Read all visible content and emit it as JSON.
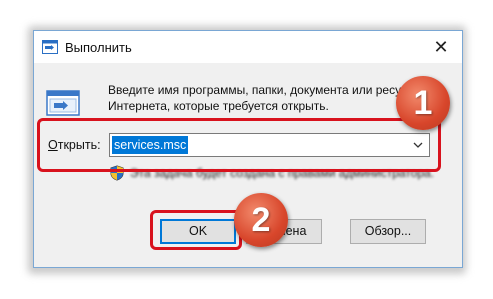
{
  "window": {
    "title": "Выполнить",
    "close_label": "✕"
  },
  "description": {
    "line1": "Введите имя программы, папки, документа или ресу",
    "line2": "Интернета, которые требуется открыть."
  },
  "open_field": {
    "label_prefix": "О",
    "label_rest": "ткрыть:",
    "value": "services.msc"
  },
  "admin_note": "Эта задача будет создана с правами администратора.",
  "buttons": {
    "ok": "OK",
    "cancel": "Отмена",
    "browse": "Обзор..."
  },
  "badges": {
    "step1": "1",
    "step2": "2"
  },
  "colors": {
    "highlight": "#d8121d",
    "badge": "#d8462b",
    "selection": "#0078d7"
  }
}
